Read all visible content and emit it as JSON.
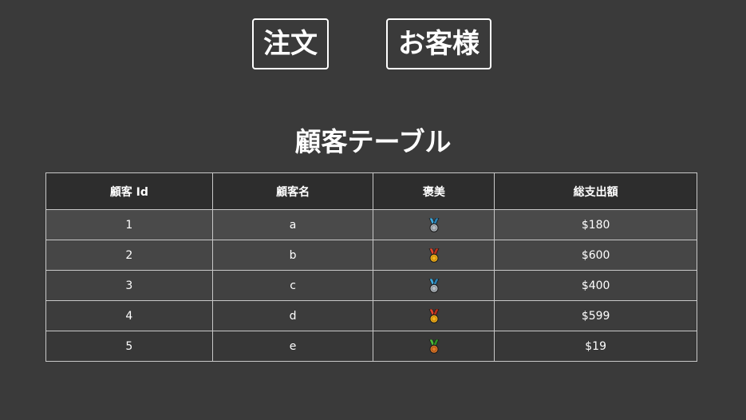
{
  "nav": {
    "orders_label": "注文",
    "customers_label": "お客様"
  },
  "page": {
    "title": "顧客テーブル"
  },
  "table": {
    "headers": [
      "顧客 Id",
      "顧客名",
      "褒美",
      "総支出額"
    ],
    "rows": [
      {
        "id": "1",
        "name": "a",
        "reward": "silver-medal-icon",
        "total": "$180"
      },
      {
        "id": "2",
        "name": "b",
        "reward": "gold-medal-icon",
        "total": "$600"
      },
      {
        "id": "3",
        "name": "c",
        "reward": "silver-medal-icon",
        "total": "$400"
      },
      {
        "id": "4",
        "name": "d",
        "reward": "gold-medal-icon",
        "total": "$599"
      },
      {
        "id": "5",
        "name": "e",
        "reward": "bronze-medal-icon",
        "total": "$19"
      }
    ]
  },
  "colors": {
    "background": "#3a3a3a",
    "text": "#ffffff",
    "header_background": "#2d2d2d",
    "border": "#c8c8c8"
  }
}
